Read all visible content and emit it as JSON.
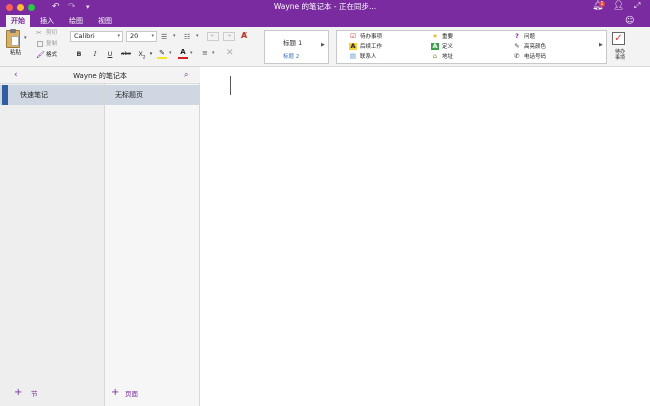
{
  "window": {
    "title": "Wayne 的笔记本 - 正在同步...",
    "notification_count": "1"
  },
  "tabs": [
    {
      "label": "开始",
      "active": true
    },
    {
      "label": "插入",
      "active": false
    },
    {
      "label": "绘图",
      "active": false
    },
    {
      "label": "视图",
      "active": false
    }
  ],
  "ribbon": {
    "clipboard": {
      "paste": "粘贴",
      "cut": "剪切",
      "copy": "复制",
      "format": "格式"
    },
    "font": {
      "family": "Calibri",
      "size": "20",
      "bold": "B",
      "italic": "I",
      "underline": "U",
      "strike": "abc",
      "subscript": "X",
      "subscript_mark": "2"
    },
    "styles": {
      "heading1": "标题 1",
      "heading2": "标题 2"
    },
    "tags": [
      {
        "icon": "checkbox-icon",
        "glyph": "☑",
        "label": "待办事项",
        "color": "#d03b3b"
      },
      {
        "icon": "highlight-a-icon",
        "glyph": "A",
        "label": "后续工作",
        "color": "#f5d23a"
      },
      {
        "icon": "contact-icon",
        "glyph": "▤",
        "label": "联系人",
        "color": "#5a8fd0"
      },
      {
        "icon": "star-icon",
        "glyph": "★",
        "label": "重要",
        "color": "#f1b92b"
      },
      {
        "icon": "definition-a-icon",
        "glyph": "A",
        "label": "定义",
        "color": "#3ca04a"
      },
      {
        "icon": "house-icon",
        "glyph": "⌂",
        "label": "地址",
        "color": "#8a6d3b"
      },
      {
        "icon": "question-icon",
        "glyph": "?",
        "label": "问题",
        "color": "#7a2ba0"
      },
      {
        "icon": "pen-icon",
        "glyph": "✎",
        "label": "高亮颜色",
        "color": "#444444"
      },
      {
        "icon": "phone-icon",
        "glyph": "✆",
        "label": "电话号码",
        "color": "#444444"
      }
    ],
    "todo_button": "待办\n事项"
  },
  "nav": {
    "notebook_title": "Wayne 的笔记本",
    "sections": [
      {
        "label": "快速笔记",
        "selected": true
      }
    ],
    "pages": [
      {
        "label": "无标题页",
        "selected": true
      }
    ],
    "add_section": "节",
    "add_page": "页面"
  },
  "colors": {
    "brand": "#7a2ba0",
    "section_marker": "#2f5f9e",
    "selection": "#cfd8e2"
  }
}
